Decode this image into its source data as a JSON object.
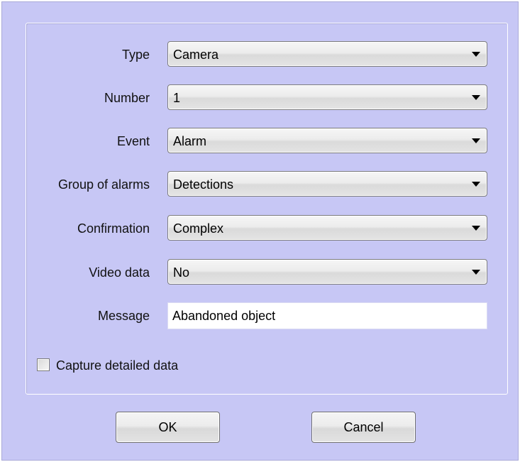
{
  "form": {
    "fields": [
      {
        "label": "Type",
        "value": "Camera"
      },
      {
        "label": "Number",
        "value": "1"
      },
      {
        "label": "Event",
        "value": "Alarm"
      },
      {
        "label": "Group of alarms",
        "value": "Detections"
      },
      {
        "label": "Confirmation",
        "value": "Complex"
      },
      {
        "label": "Video data",
        "value": "No"
      }
    ],
    "message": {
      "label": "Message",
      "value": "Abandoned object"
    },
    "capture": {
      "label": "Capture detailed data",
      "checked": false
    }
  },
  "buttons": {
    "ok_label": "OK",
    "cancel_label": "Cancel"
  },
  "icons": {
    "dropdown": "chevron-down-icon",
    "checkbox": "checkbox-unchecked-icon"
  },
  "colors": {
    "dialog_background": "#c7c7f5",
    "field_background": "#ffffff",
    "control_border": "#7c7c7c"
  }
}
